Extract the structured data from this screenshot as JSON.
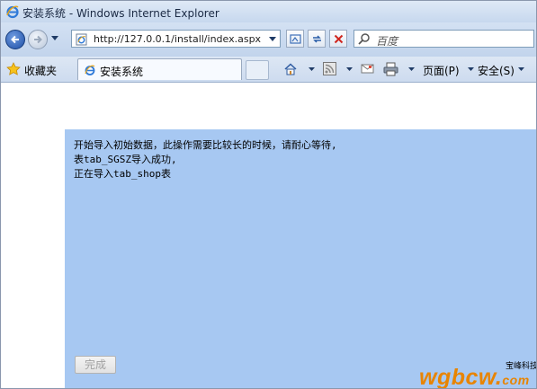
{
  "window": {
    "title": "安装系统 - Windows Internet Explorer"
  },
  "address_bar": {
    "url": "http://127.0.0.1/install/index.aspx"
  },
  "search": {
    "placeholder": "百度"
  },
  "favorites": {
    "label": "收藏夹"
  },
  "tab": {
    "label": "安装系统"
  },
  "commands": {
    "page_label": "页面(P)",
    "safety_label": "安全(S)"
  },
  "content": {
    "lines": [
      "开始导入初始数据，此操作需要比较长的时候，请耐心等待,",
      "表tab_SGSZ导入成功,",
      "正在导入tab_shop表"
    ],
    "finish_button": "完成"
  },
  "watermark": {
    "company": "宝峰科技",
    "site": "wgbcw",
    "tld": "com"
  },
  "colors": {
    "panel_bg": "#a7c8f2",
    "watermark": "#e88400"
  }
}
